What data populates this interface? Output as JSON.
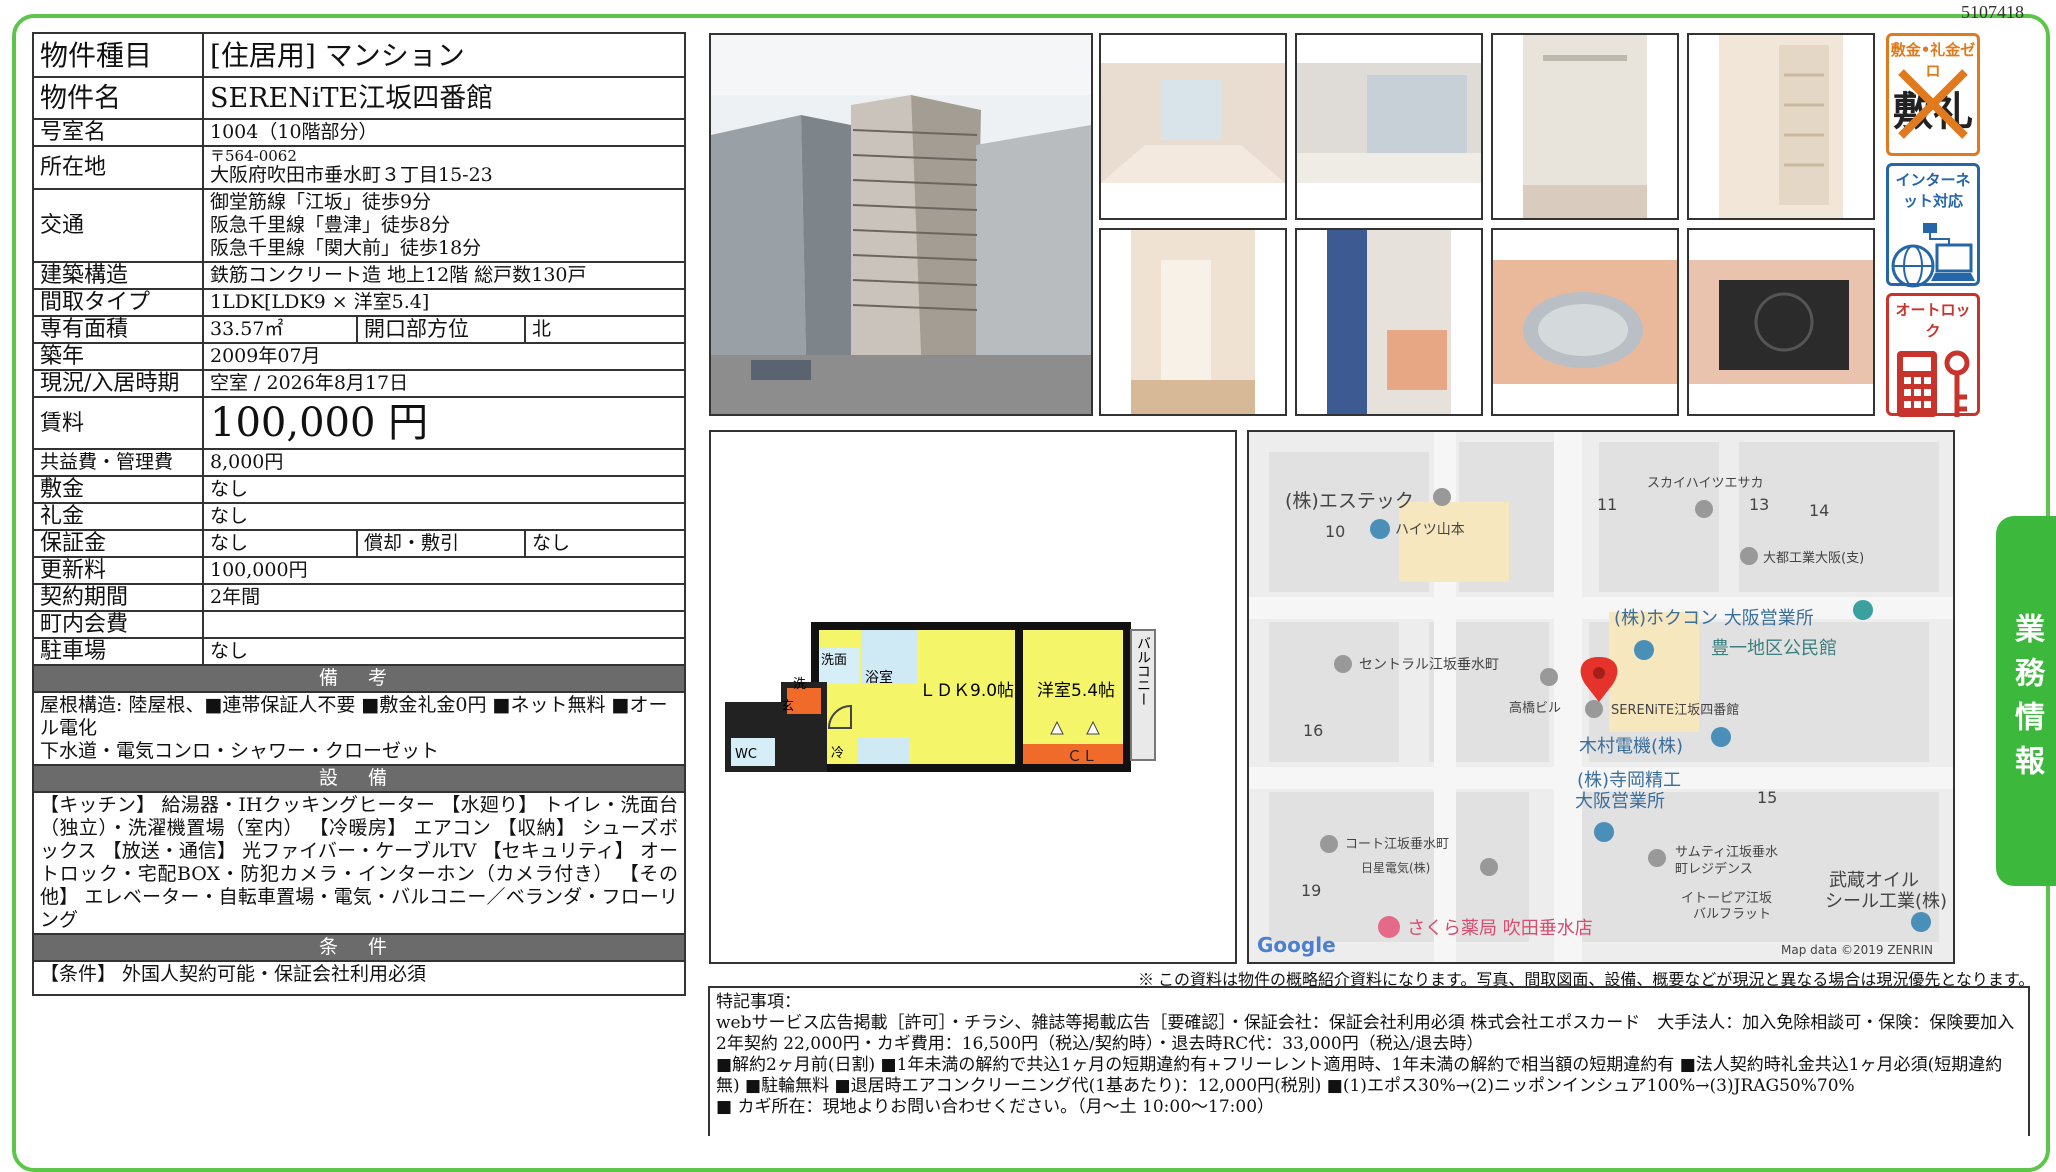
{
  "doc_id": "5107418",
  "spec": {
    "type_label": "物件種目",
    "type_value": "[住居用] マンション",
    "name_label": "物件名",
    "name_value": "SERENiTE江坂四番館",
    "room_label": "号室名",
    "room_value": "1004（10階部分）",
    "address_label": "所在地",
    "zip": "〒564-0062",
    "address_value": "大阪府吹田市垂水町３丁目15-23",
    "transport_label": "交通",
    "transport_lines": [
      "御堂筋線「江坂」徒歩9分",
      "阪急千里線「豊津」徒歩8分",
      "阪急千里線「関大前」徒歩18分"
    ],
    "structure_label": "建築構造",
    "structure_value": "鉄筋コンクリート造 地上12階 総戸数130戸",
    "layout_label": "間取タイプ",
    "layout_value": "1LDK[LDK9 × 洋室5.4]",
    "area_label": "専有面積",
    "area_value": "33.57㎡",
    "opening_label": "開口部方位",
    "opening_value": "北",
    "built_label": "築年",
    "built_value": "2009年07月",
    "status_label": "現況/入居時期",
    "status_value": "空室 / 2026年8月17日",
    "rent_label": "賃料",
    "rent_value": "100,000 円",
    "fee_label": "共益費・管理費",
    "fee_value": "8,000円",
    "deposit_label": "敷金",
    "deposit_value": "なし",
    "keymoney_label": "礼金",
    "keymoney_value": "なし",
    "guarantee_label": "保証金",
    "guarantee_value": "なし",
    "amort_label": "償却・敷引",
    "amort_value": "なし",
    "renewal_label": "更新料",
    "renewal_value": "100,000円",
    "term_label": "契約期間",
    "term_value": "2年間",
    "town_label": "町内会費",
    "town_value": "",
    "parking_label": "駐車場",
    "parking_value": "なし"
  },
  "bikou": {
    "title": "備 考",
    "text1": "屋根構造: 陸屋根、■連帯保証人不要 ■敷金礼金0円 ■ネット無料 ■オール電化",
    "text2": "下水道・電気コンロ・シャワー・クローゼット"
  },
  "setsubi": {
    "title": "設 備",
    "text": "【キッチン】 給湯器・IHクッキングヒーター 【水廻り】 トイレ・洗面台（独立）・洗濯機置場（室内） 【冷暖房】 エアコン 【収納】 シューズボックス 【放送・通信】 光ファイバー・ケーブルTV 【セキュリティ】 オートロック・宅配BOX・防犯カメラ・インターホン（カメラ付き） 【その他】 エレベーター・自転車置場・電気・バルコニー／ベランダ・フローリング"
  },
  "jouken": {
    "title": "条 件",
    "text": "【条件】 外国人契約可能・保証会社利用必須"
  },
  "icons": {
    "shikirei": "敷金•礼金ゼロ",
    "shikirei_glyph": "敷礼",
    "internet": "インターネット対応",
    "autolock": "オートロック"
  },
  "floorplan": {
    "ldk": "ＬＤＫ9.0帖",
    "western": "洋室5.4帖",
    "cl": "ＣＬ",
    "balcony": "バルコニー",
    "bath": "浴室",
    "washroom": "洗面",
    "wash": "洗",
    "wc": "WC",
    "fridge": "冷",
    "entrance": "玄"
  },
  "map": {
    "labels": [
      "(株)エステック",
      "ハイツ山本",
      "スカイハイツエサカ",
      "大都工業大阪(支)",
      "(株)ホクコン 大阪営業所",
      "豊一地区公民館",
      "セントラル江坂垂水町",
      "高橋ビル",
      "SERENiTE江坂四番館",
      "木村電機(株)",
      "(株)寺岡精工",
      "大阪営業所",
      "コート江坂垂水町",
      "日星電気(株)",
      "サムティ江坂垂水",
      "町レジデンス",
      "イトーピア江坂",
      "バルフラット",
      "武蔵オイル",
      "シール工業(株)",
      "さくら薬局 吹田垂水店"
    ],
    "blocks": [
      "10",
      "11",
      "13",
      "14",
      "16",
      "15",
      "19"
    ],
    "google": "Google",
    "credit": "Map data ©2019 ZENRIN"
  },
  "disclaimer": "※ この資料は物件の概略紹介資料になります。写真、間取図面、設備、概要などが現況と異なる場合は現況優先となります。",
  "remarks": {
    "title": "特記事項：",
    "line1": "webサービス広告掲載［許可］・チラシ、雑誌等掲載広告［要確認］・保証会社：保証会社利用必須 株式会社エポスカード　大手法人：加入免除相談可・保険：保険要加入 2年契約 22,000円・カギ費用：16,500円（税込/契約時）・退去時RC代：33,000円（税込/退去時）",
    "line2": "■解約2ヶ月前(日割) ■1年未満の解約で共込1ヶ月の短期違約有+フリーレント適用時、1年未満の解約で相当額の短期違約有 ■法人契約時礼金共込1ヶ月必須(短期違約無) ■駐輪無料 ■退居時エアコンクリーニング代(1基あたり)：12,000円(税別) ■(1)エポス30%→(2)ニッポンインシュア100%→(3)JRAG50%70%",
    "line3": "■ カギ所在：現地よりお問い合わせください。（月～土 10:00～17:00）"
  },
  "side_tab": "業務情報"
}
